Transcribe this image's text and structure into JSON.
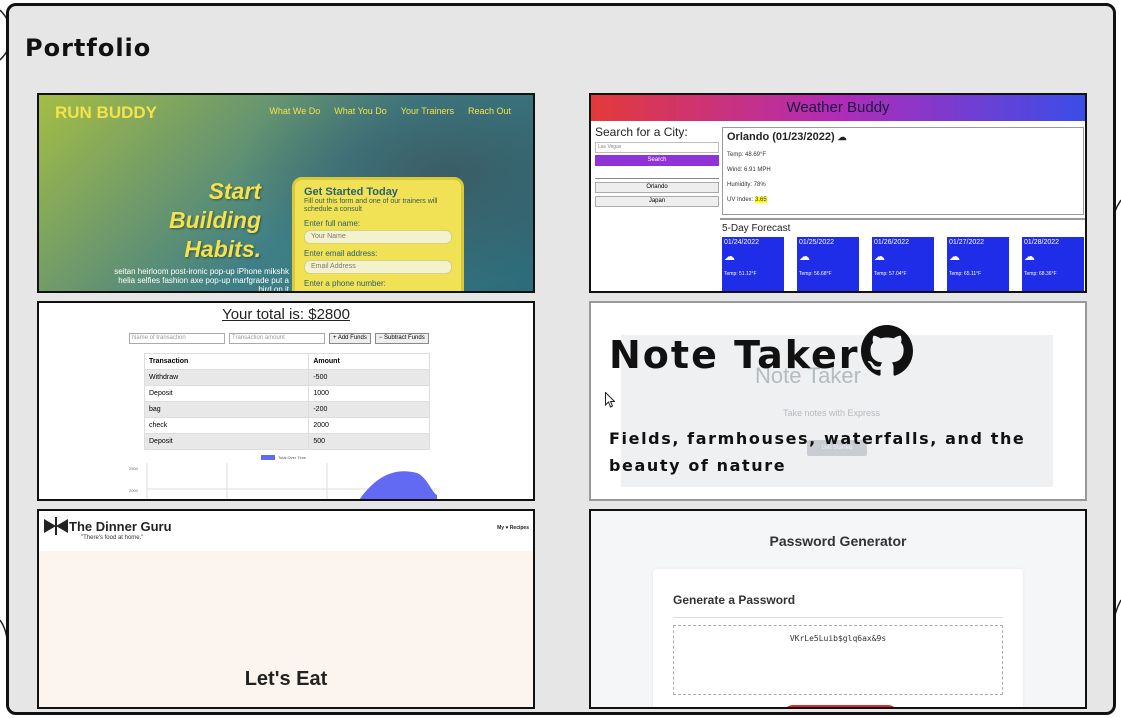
{
  "portfolio": {
    "title": "Portfolio"
  },
  "run_buddy": {
    "logo": "RUN BUDDY",
    "nav": [
      "What We Do",
      "What You Do",
      "Your Trainers",
      "Reach Out"
    ],
    "headline": [
      "Start",
      "Building",
      "Habits."
    ],
    "body": "seitan heirloom post-ironic pop-up iPhone mikshk helia selfies fashion axe pop-up marfgrade put a bird on it",
    "form": {
      "title": "Get Started Today",
      "subtitle": "Fill out this form and one of our trainers will schedule a consult",
      "name_label": "Enter full name:",
      "name_placeholder": "Your Name",
      "email_label": "Enter email address:",
      "email_placeholder": "Email Address",
      "phone_label": "Enter a phone number:"
    }
  },
  "weather": {
    "title": "Weather Buddy",
    "search_label": "Search for a City:",
    "search_placeholder": "Las Vegas",
    "search_button": "Search",
    "history": [
      "Orlando",
      "Japan"
    ],
    "current": {
      "city": "Orlando (01/23/2022)",
      "temp": "Temp: 48.69°F",
      "wind": "Wind: 6.91 MPH",
      "humidity": "Humidity: 78%",
      "uv_label": "UV Index:",
      "uv_value": "3.65"
    },
    "forecast_title": "5-Day Forecast",
    "days": [
      {
        "date": "01/24/2022",
        "temp": "Temp: 51.12°F"
      },
      {
        "date": "01/25/2022",
        "temp": "Temp: 56.68°F"
      },
      {
        "date": "01/26/2022",
        "temp": "Temp: 57.04°F"
      },
      {
        "date": "01/27/2022",
        "temp": "Temp: 65.11°F"
      },
      {
        "date": "01/28/2022",
        "temp": "Temp: 68.36°F"
      }
    ]
  },
  "budget": {
    "total": "Your total is: $2800",
    "name_placeholder": "Name of transaction",
    "amount_placeholder": "Transaction amount",
    "add_button": "+ Add Funds",
    "subtract_button": "− Subtract Funds",
    "columns": [
      "Transaction",
      "Amount"
    ],
    "rows": [
      [
        "Withdraw",
        "-500"
      ],
      [
        "Deposit",
        "1000"
      ],
      [
        "bag",
        "-200"
      ],
      [
        "check",
        "2000"
      ],
      [
        "Deposit",
        "500"
      ]
    ],
    "legend": "Total Over Time",
    "y_ticks": [
      "2500",
      "2000"
    ]
  },
  "note_taker": {
    "title": "Note Taker",
    "bg_title": "Note Taker",
    "bg_subtitle": "Take notes with Express",
    "bg_button": "Get Started",
    "description": "Fields, farmhouses, waterfalls, and the beauty of nature"
  },
  "dinner": {
    "logo": "The Dinner Guru",
    "tagline": "\"There's food at home.\"",
    "my_recipes": "My ♥ Recipes",
    "cta": "Let's Eat"
  },
  "password": {
    "title": "Password Generator",
    "card_title": "Generate a Password",
    "generated": "VKrLe5Luib$glq6ax&9s"
  }
}
